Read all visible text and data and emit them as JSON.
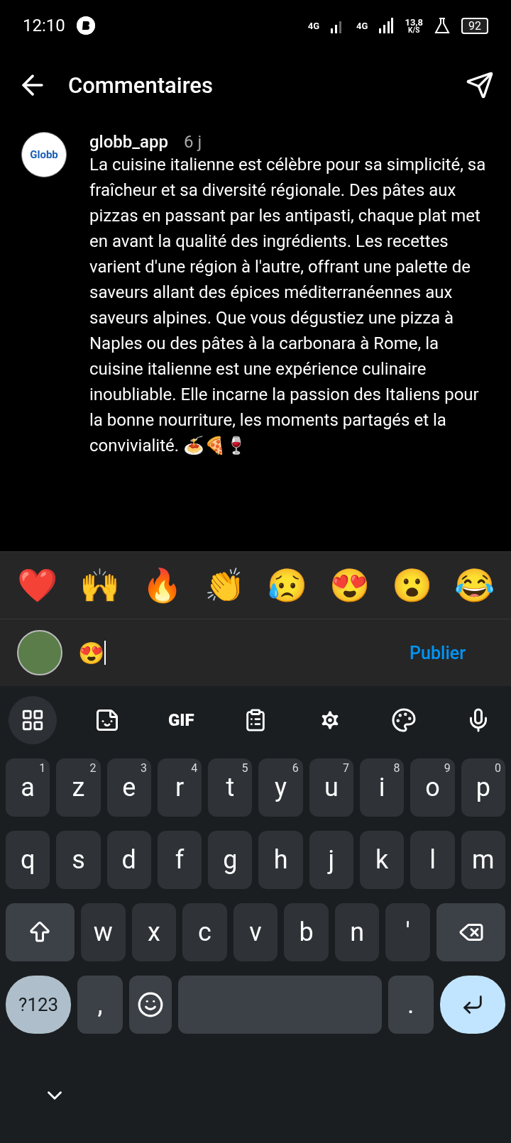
{
  "status_bar": {
    "time": "12:10",
    "network_1": "4G",
    "network_2": "4G",
    "speed": "13,8",
    "speed_unit": "K/S",
    "battery": "92"
  },
  "header": {
    "title": "Commentaires"
  },
  "comment": {
    "author": "globb_app",
    "avatar_text": "Globb",
    "age": "6 j",
    "text": "La cuisine italienne est célèbre pour sa simplicité, sa fraîcheur et sa diversité régionale. Des pâtes aux pizzas en passant par les antipasti, chaque plat met en avant la qualité des ingrédients. Les recettes varient d'une région à l'autre, offrant une palette de saveurs allant des épices méditerranéennes aux saveurs alpines. Que vous dégustiez une pizza à Naples ou des pâtes à la carbonara à Rome, la cuisine italienne est une expérience culinaire inoubliable. Elle incarne la passion des Italiens pour la bonne nourriture, les moments partagés et la convivialité. 🍝🍕🍷"
  },
  "emoji_bar": [
    "❤️",
    "🙌",
    "🔥",
    "👏",
    "😥",
    "😍",
    "😮",
    "😂"
  ],
  "composer": {
    "value": "😍",
    "publish": "Publier"
  },
  "keyboard_toolbar": [
    {
      "kind": "apps",
      "selected": true
    },
    {
      "kind": "sticker",
      "selected": false
    },
    {
      "kind": "gif",
      "label": "GIF",
      "selected": false
    },
    {
      "kind": "clipboard",
      "selected": false
    },
    {
      "kind": "settings",
      "selected": false
    },
    {
      "kind": "theme",
      "selected": false
    },
    {
      "kind": "mic",
      "selected": false
    }
  ],
  "keyboard_rows": [
    [
      {
        "kind": "letter",
        "label": "a",
        "hint": "1"
      },
      {
        "kind": "letter",
        "label": "z",
        "hint": "2"
      },
      {
        "kind": "letter",
        "label": "e",
        "hint": "3"
      },
      {
        "kind": "letter",
        "label": "r",
        "hint": "4"
      },
      {
        "kind": "letter",
        "label": "t",
        "hint": "5"
      },
      {
        "kind": "letter",
        "label": "y",
        "hint": "6"
      },
      {
        "kind": "letter",
        "label": "u",
        "hint": "7"
      },
      {
        "kind": "letter",
        "label": "i",
        "hint": "8"
      },
      {
        "kind": "letter",
        "label": "o",
        "hint": "9"
      },
      {
        "kind": "letter",
        "label": "p",
        "hint": "0"
      }
    ],
    [
      {
        "kind": "letter",
        "label": "q"
      },
      {
        "kind": "letter",
        "label": "s"
      },
      {
        "kind": "letter",
        "label": "d"
      },
      {
        "kind": "letter",
        "label": "f"
      },
      {
        "kind": "letter",
        "label": "g"
      },
      {
        "kind": "letter",
        "label": "h"
      },
      {
        "kind": "letter",
        "label": "j"
      },
      {
        "kind": "letter",
        "label": "k"
      },
      {
        "kind": "letter",
        "label": "l"
      },
      {
        "kind": "letter",
        "label": "m"
      }
    ],
    [
      {
        "kind": "shift"
      },
      {
        "kind": "letter",
        "label": "w"
      },
      {
        "kind": "letter",
        "label": "x"
      },
      {
        "kind": "letter",
        "label": "c"
      },
      {
        "kind": "letter",
        "label": "v"
      },
      {
        "kind": "letter",
        "label": "b"
      },
      {
        "kind": "letter",
        "label": "n"
      },
      {
        "kind": "letter",
        "label": "'"
      },
      {
        "kind": "backspace"
      }
    ],
    [
      {
        "kind": "symbols",
        "label": "?123"
      },
      {
        "kind": "letter",
        "label": ","
      },
      {
        "kind": "emoji"
      },
      {
        "kind": "space"
      },
      {
        "kind": "letter",
        "label": "."
      },
      {
        "kind": "enter"
      }
    ]
  ]
}
